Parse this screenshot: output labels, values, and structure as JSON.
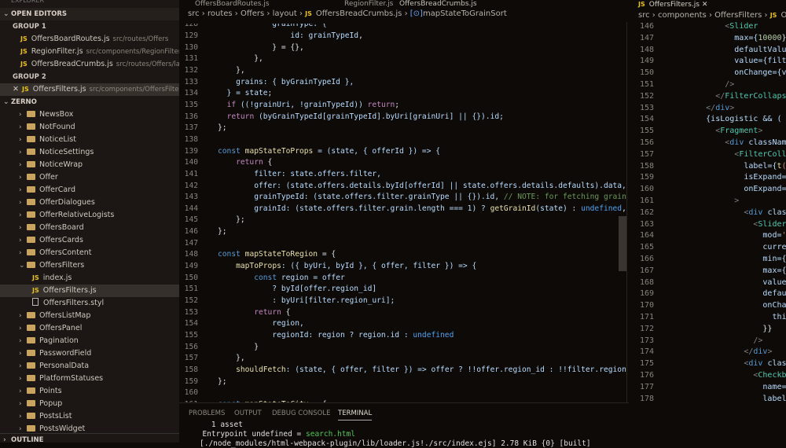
{
  "sidebar": {
    "explorer_title": "EXPLORER",
    "open_editors": "OPEN EDITORS",
    "group1": "GROUP 1",
    "group1_files": [
      {
        "name": "OffersBoardRoutes.js",
        "path": "src/routes/Offers"
      },
      {
        "name": "RegionFilter.js",
        "path": "src/components/RegionFilter"
      },
      {
        "name": "OffersBreadCrumbs.js",
        "path": "src/routes/Offers/la..."
      }
    ],
    "group2": "GROUP 2",
    "group2_files": [
      {
        "name": "OffersFilters.js",
        "path": "src/components/OffersFilters"
      }
    ],
    "project": "ZERNO",
    "folders_before": [
      "NewsBox",
      "NotFound",
      "NoticeList",
      "NoticeSettings",
      "NoticeWrap",
      "Offer",
      "OfferCard",
      "OfferDialogues",
      "OfferRelativeLogists",
      "OffersBoard",
      "OffersCards",
      "OffersContent"
    ],
    "expanded_folder": "OffersFilters",
    "expanded_files": [
      {
        "name": "index.js",
        "type": "js"
      },
      {
        "name": "OffersFilters.js",
        "type": "js"
      },
      {
        "name": "OffersFilters.styl",
        "type": "file"
      }
    ],
    "folders_after": [
      "OffersListMap",
      "OffersPanel",
      "Pagination",
      "PasswordField",
      "PersonalData",
      "PlatformStatuses",
      "Points",
      "Popup",
      "PostsList",
      "PostsWidget"
    ],
    "outline": "OUTLINE"
  },
  "tabs_left": [
    "OffersBoardRoutes.js",
    "RegionFilter.js",
    "OffersBreadCrumbs.js"
  ],
  "breadcrumb_left": {
    "parts": [
      "src",
      "routes",
      "Offers",
      "layout"
    ],
    "file": "OffersBreadCrumbs.js",
    "symbol": "mapStateToGrainSort"
  },
  "tab_right": "OffersFilters.js",
  "breadcrumb_right": {
    "parts": [
      "src",
      "components",
      "OffersFilters"
    ],
    "file": "Of"
  },
  "code_left": {
    "start": 128,
    "lines": [
      [
        [
          "            grainType: {",
          "v"
        ]
      ],
      [
        [
          "                id: ",
          "v"
        ],
        [
          "grainTypeId",
          "v"
        ],
        [
          ",",
          ""
        ]
      ],
      [
        [
          "            } = {},",
          ""
        ]
      ],
      [
        [
          "        },",
          ""
        ]
      ],
      [
        [
          "    },",
          ""
        ]
      ],
      [
        [
          "    grains: { byGrainTypeId },",
          "v"
        ]
      ],
      [
        [
          "  } = ",
          "v"
        ],
        [
          "state",
          "v"
        ],
        [
          ";",
          ""
        ]
      ],
      [
        [
          "  ",
          ""
        ],
        [
          "if",
          "r"
        ],
        [
          " ((!grainUri, !grainTypeId)) ",
          "v"
        ],
        [
          "return",
          "r"
        ],
        [
          ";",
          ""
        ]
      ],
      [
        [
          "  ",
          ""
        ],
        [
          "return",
          "r"
        ],
        [
          " (byGrainTypeId[grainTypeId].byUri[grainUri] || {}).id;",
          "v"
        ]
      ],
      [
        [
          "};",
          ""
        ]
      ],
      [
        [
          "",
          ""
        ]
      ],
      [
        [
          "const",
          "k"
        ],
        [
          " ",
          ""
        ],
        [
          "mapStateToProps",
          "f"
        ],
        [
          " = (state, { offerId }) => {",
          "v"
        ]
      ],
      [
        [
          "    ",
          ""
        ],
        [
          "return",
          "r"
        ],
        [
          " {",
          ""
        ]
      ],
      [
        [
          "        filter: state.offers.filter,",
          "v"
        ]
      ],
      [
        [
          "        offer: (state.offers.details.byId[offerId] || state.offers.details.defaults).data,",
          "v"
        ]
      ],
      [
        [
          "        grainTypeId: (state.offers.filter.grainType || {}).id, ",
          "v"
        ],
        [
          "// NOTE: for fetching grains",
          "c"
        ]
      ],
      [
        [
          "        grainId: (state.offers.filter.grain.length === 1) ? ",
          "v"
        ],
        [
          "getGrainId",
          "f"
        ],
        [
          "(state) : ",
          "v"
        ],
        [
          "undefined",
          "u"
        ],
        [
          ",",
          ""
        ]
      ],
      [
        [
          "    };",
          ""
        ]
      ],
      [
        [
          "};",
          ""
        ]
      ],
      [
        [
          "",
          ""
        ]
      ],
      [
        [
          "const",
          "k"
        ],
        [
          " ",
          ""
        ],
        [
          "mapStateToRegion",
          "f"
        ],
        [
          " = {",
          ""
        ]
      ],
      [
        [
          "    ",
          ""
        ],
        [
          "mapToProps",
          "f"
        ],
        [
          ": ({ byUri, byId }, { offer, filter }) => {",
          "v"
        ]
      ],
      [
        [
          "        ",
          ""
        ],
        [
          "const",
          "k"
        ],
        [
          " region = offer",
          "v"
        ]
      ],
      [
        [
          "            ? byId[offer.region_id]",
          "v"
        ]
      ],
      [
        [
          "            : byUri[filter.region_uri];",
          "v"
        ]
      ],
      [
        [
          "        ",
          ""
        ],
        [
          "return",
          "r"
        ],
        [
          " {",
          ""
        ]
      ],
      [
        [
          "            region,",
          "v"
        ]
      ],
      [
        [
          "            regionId: region ? region.id : ",
          "v"
        ],
        [
          "undefined",
          "u"
        ]
      ],
      [
        [
          "        }",
          ""
        ]
      ],
      [
        [
          "    },",
          ""
        ]
      ],
      [
        [
          "    ",
          ""
        ],
        [
          "shouldFetch",
          "f"
        ],
        [
          ": (state, { offer, filter }) => offer ? !!offer.region_id : !!filter.region_",
          "v"
        ]
      ],
      [
        [
          "};",
          ""
        ]
      ],
      [
        [
          "",
          ""
        ]
      ],
      [
        [
          "const",
          "k"
        ],
        [
          " ",
          ""
        ],
        [
          "mapStateToCity",
          "f"
        ],
        [
          " = {",
          ""
        ]
      ]
    ]
  },
  "code_right": {
    "start": 146,
    "lines": [
      [
        [
          "            <",
          "g"
        ],
        [
          "Slider",
          "t"
        ]
      ],
      [
        [
          "              max={",
          "v"
        ],
        [
          "10000",
          "n"
        ],
        [
          "}",
          ""
        ]
      ],
      [
        [
          "              defaultValue",
          "v"
        ]
      ],
      [
        [
          "              value={filte",
          "v"
        ]
      ],
      [
        [
          "              onChange={va",
          "v"
        ]
      ],
      [
        [
          "            />",
          "g"
        ]
      ],
      [
        [
          "          </",
          "g"
        ],
        [
          "FilterCollapse",
          "t"
        ]
      ],
      [
        [
          "        </",
          "g"
        ],
        [
          "div",
          "k"
        ],
        [
          ">",
          "g"
        ]
      ],
      [
        [
          "        {isLogistic && (",
          "v"
        ]
      ],
      [
        [
          "          <",
          "g"
        ],
        [
          "Fragment",
          "t"
        ],
        [
          ">",
          "g"
        ]
      ],
      [
        [
          "            <",
          "g"
        ],
        [
          "div",
          "k"
        ],
        [
          " className",
          "v"
        ]
      ],
      [
        [
          "              <",
          "g"
        ],
        [
          "FilterColla",
          "t"
        ]
      ],
      [
        [
          "                label={",
          "v"
        ],
        [
          "t",
          "f"
        ],
        [
          "('",
          "s"
        ]
      ],
      [
        [
          "                isExpand={",
          "v"
        ]
      ],
      [
        [
          "                onExpand={",
          "v"
        ]
      ],
      [
        [
          "              >",
          "g"
        ]
      ],
      [
        [
          "                <",
          "g"
        ],
        [
          "div",
          "k"
        ],
        [
          " class",
          "v"
        ]
      ],
      [
        [
          "                  <",
          "g"
        ],
        [
          "Slider",
          "t"
        ]
      ],
      [
        [
          "                    mod=",
          "v"
        ],
        [
          "'c",
          "s"
        ]
      ],
      [
        [
          "                    curren",
          "v"
        ]
      ],
      [
        [
          "                    min={",
          "v"
        ],
        [
          "0",
          "n"
        ]
      ],
      [
        [
          "                    max={",
          "v"
        ],
        [
          "1",
          "n"
        ]
      ],
      [
        [
          "                    value=",
          "v"
        ]
      ],
      [
        [
          "                    defaul",
          "v"
        ]
      ],
      [
        [
          "                    onChang",
          "v"
        ]
      ],
      [
        [
          "                      this.",
          "v"
        ]
      ],
      [
        [
          "                    }}",
          ""
        ]
      ],
      [
        [
          "                  />",
          "g"
        ]
      ],
      [
        [
          "                </",
          "g"
        ],
        [
          "div",
          "k"
        ],
        [
          ">",
          "g"
        ]
      ],
      [
        [
          "                <",
          "g"
        ],
        [
          "div",
          "k"
        ],
        [
          " classN",
          "v"
        ]
      ],
      [
        [
          "                  <",
          "g"
        ],
        [
          "Checkbox",
          "t"
        ]
      ],
      [
        [
          "                    name=",
          "v"
        ],
        [
          "'p",
          "s"
        ]
      ],
      [
        [
          "                    label={",
          "v"
        ]
      ]
    ]
  },
  "panel": {
    "tabs": [
      "PROBLEMS",
      "OUTPUT",
      "DEBUG CONSOLE",
      "TERMINAL"
    ],
    "active": "TERMINAL",
    "terminal": [
      "    1 asset",
      "  Entrypoint undefined = ",
      "[./node_modules/html-webpack-plugin/lib/loader.js!./src/index.ejs] 2.78 KiB {0} [built]"
    ],
    "terminal_link": "search.html"
  }
}
